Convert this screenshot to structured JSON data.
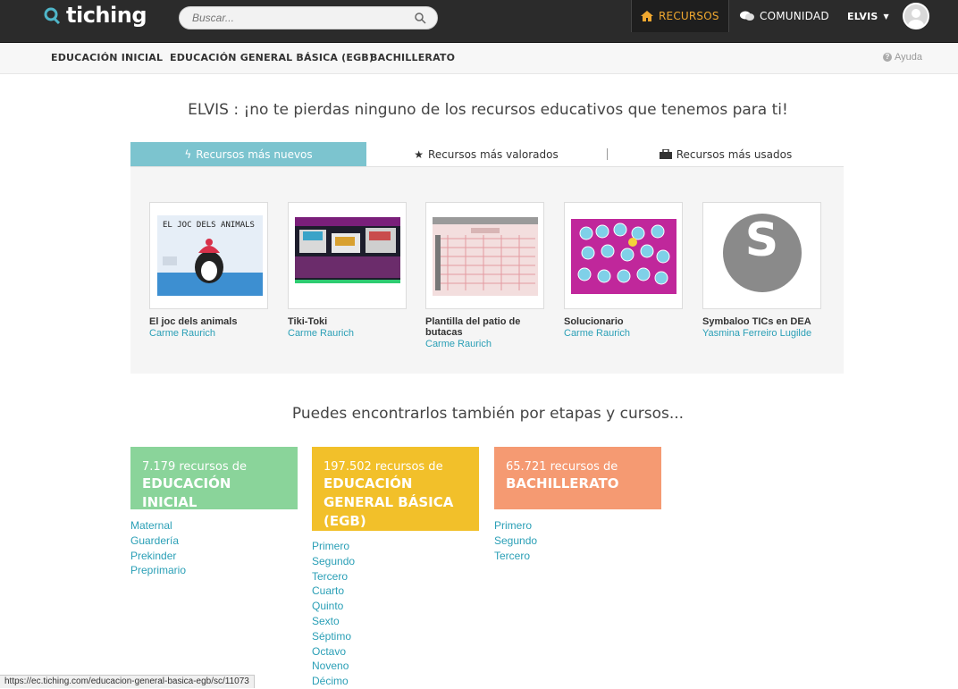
{
  "header": {
    "logo_text": "tiching",
    "search_placeholder": "Buscar...",
    "nav": {
      "recursos": "RECURSOS",
      "comunidad": "COMUNIDAD",
      "user": "ELVIS"
    }
  },
  "subnav": {
    "items": [
      "EDUCACIÓN INICIAL",
      "EDUCACIÓN GENERAL BÁSICA (EGB)",
      "BACHILLERATO"
    ],
    "help": "Ayuda"
  },
  "headline": "ELVIS : ¡no te pierdas ninguno de los recursos educativos que tenemos para ti!",
  "tabs": [
    "Recursos más nuevos",
    "Recursos más valorados",
    "Recursos más usados"
  ],
  "cards": [
    {
      "title": "El joc dels animals",
      "author": "Carme Raurich",
      "thumb_text": "EL JOC DELS ANIMALS"
    },
    {
      "title": "Tiki-Toki",
      "author": "Carme Raurich"
    },
    {
      "title": "Plantilla del patio de butacas",
      "author": "Carme Raurich"
    },
    {
      "title": "Solucionario",
      "author": "Carme Raurich"
    },
    {
      "title": "Symbaloo TICs en DEA",
      "author": "Yasmina Ferreiro Lugilde",
      "thumb_letter": "S"
    }
  ],
  "stages_title": "Puedes encontrarlos también por etapas y cursos...",
  "stages": [
    {
      "count": "7.179 recursos de",
      "name": "EDUCACIÓN INICIAL",
      "color": "#8ad49a",
      "items": [
        "Maternal",
        "Guardería",
        "Prekinder",
        "Preprimario"
      ]
    },
    {
      "count": "197.502 recursos de",
      "name": "EDUCACIÓN GENERAL BÁSICA (EGB)",
      "color": "#f2c02a",
      "items": [
        "Primero",
        "Segundo",
        "Tercero",
        "Cuarto",
        "Quinto",
        "Sexto",
        "Séptimo",
        "Octavo",
        "Noveno",
        "Décimo"
      ]
    },
    {
      "count": "65.721 recursos de",
      "name": "BACHILLERATO",
      "color": "#f59a72",
      "items": [
        "Primero",
        "Segundo",
        "Tercero"
      ]
    }
  ],
  "statusbar": "https://ec.tiching.com/educacion-general-basica-egb/sc/11073",
  "colors": {
    "accent": "#7cc4cf",
    "link": "#2a9fb6",
    "topbar": "#2b2b2b",
    "recursos": "#f0a830"
  }
}
